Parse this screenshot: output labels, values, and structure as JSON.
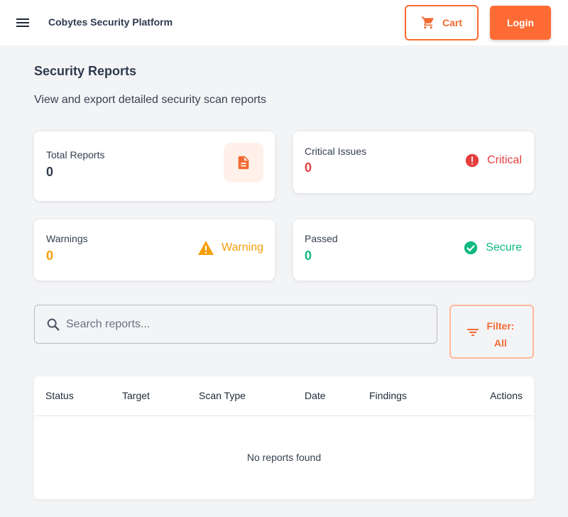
{
  "header": {
    "title": "Cobytes Security Platform",
    "menu_icon": "menu-icon",
    "cart_label": "Cart",
    "cart_icon": "cart-icon",
    "login_label": "Login",
    "accent": "#ff6b35"
  },
  "page": {
    "title": "Security Reports",
    "subtitle": "View and export detailed security scan reports"
  },
  "stats": {
    "total": {
      "label": "Total Reports",
      "value": "0",
      "icon": "document-icon"
    },
    "critical": {
      "label": "Critical Issues",
      "value": "0",
      "status": "Critical",
      "icon": "alert-circle-icon",
      "color": "#e53e3e"
    },
    "warnings": {
      "label": "Warnings",
      "value": "0",
      "status": "Warning",
      "icon": "warning-icon",
      "color": "#f59e0b"
    },
    "passed": {
      "label": "Passed",
      "value": "0",
      "status": "Secure",
      "icon": "check-circle-icon",
      "color": "#10b981"
    }
  },
  "search": {
    "placeholder": "Search reports..."
  },
  "filter": {
    "label": "Filter:",
    "value": "All"
  },
  "table": {
    "columns": [
      "Status",
      "Target",
      "Scan Type",
      "Date",
      "Findings",
      "Actions"
    ],
    "rows": [],
    "empty_message": "No reports found"
  }
}
